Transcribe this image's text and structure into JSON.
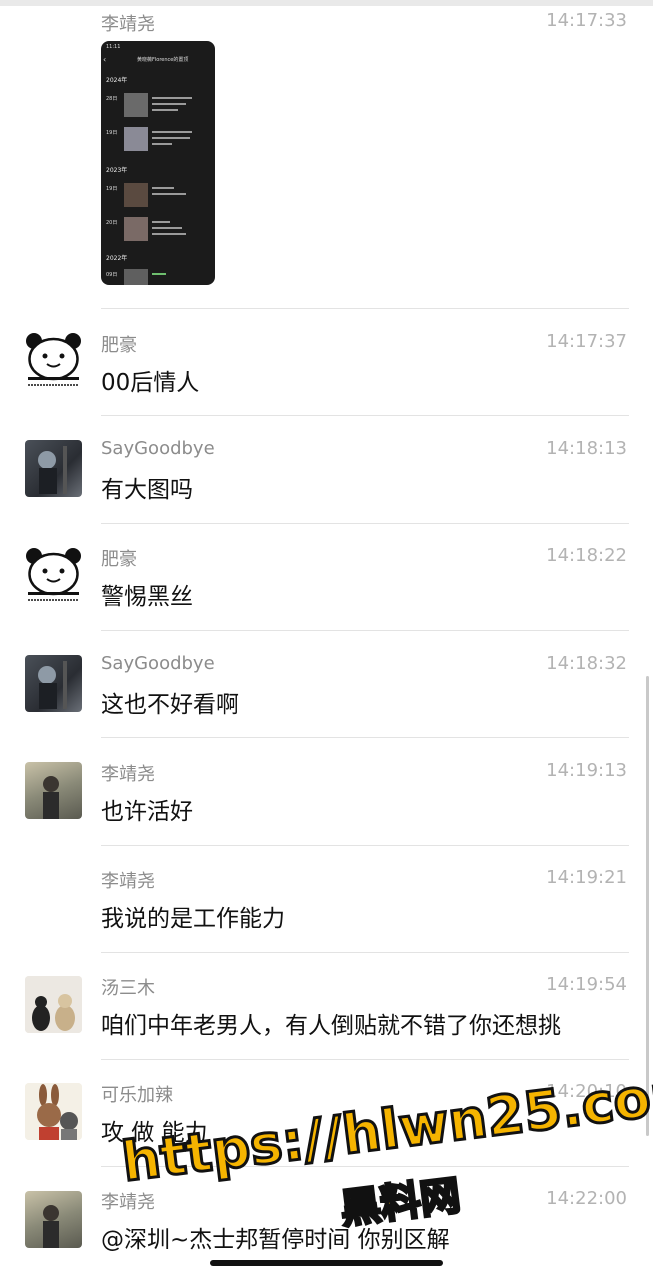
{
  "messages": [
    {
      "sender": "李靖尧",
      "time": "14:17:33",
      "text": "",
      "avatar": "none",
      "image": {
        "title": "黄晓薇Florence的置顶",
        "status_time": "11:11",
        "years": [
          "2024年",
          "2023年",
          "2022年"
        ],
        "entries": [
          "28日",
          "19日",
          "19日",
          "20日",
          "09日"
        ]
      }
    },
    {
      "sender": "肥豪",
      "time": "14:17:37",
      "text": "00后情人",
      "avatar": "panda-icon"
    },
    {
      "sender": "SayGoodbye",
      "time": "14:18:13",
      "text": "有大图吗",
      "avatar": "photo-avatar"
    },
    {
      "sender": "肥豪",
      "time": "14:18:22",
      "text": "警惕黑丝",
      "avatar": "panda-icon"
    },
    {
      "sender": "SayGoodbye",
      "time": "14:18:32",
      "text": "这也不好看啊",
      "avatar": "photo-avatar"
    },
    {
      "sender": "李靖尧",
      "time": "14:19:13",
      "text": "也许活好",
      "avatar": "photo-avatar"
    },
    {
      "sender": "李靖尧",
      "time": "14:19:21",
      "text": "我说的是工作能力",
      "avatar": "none"
    },
    {
      "sender": "汤三木",
      "time": "14:19:54",
      "text": "咱们中年老男人，有人倒贴就不错了你还想挑",
      "avatar": "cat-avatar"
    },
    {
      "sender": "可乐加辣",
      "time": "14:20:10",
      "text": "攻 做 能力",
      "avatar": "cartoon-avatar"
    },
    {
      "sender": "李靖尧",
      "time": "14:22:00",
      "text": "@深圳~杰士邦暂停时间 你别区解",
      "avatar": "photo-avatar"
    }
  ],
  "watermark": {
    "line1": "https://hlwn25.com",
    "line2": "黑料网"
  }
}
